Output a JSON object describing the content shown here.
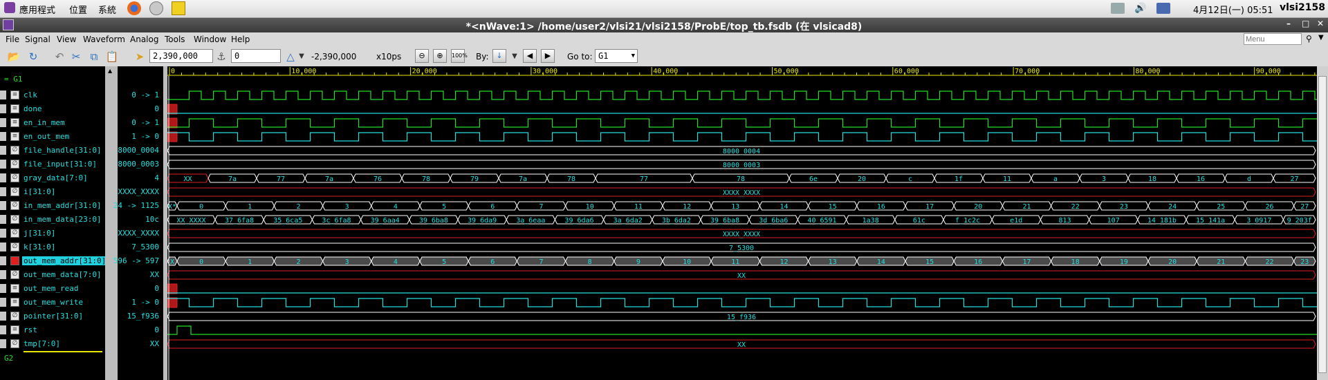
{
  "desktop": {
    "apps_label": "應用程式",
    "places_label": "位置",
    "system_label": "系統",
    "clock": "4月12日(一) 05:51",
    "user": "vlsi2158"
  },
  "window": {
    "title": "*<nWave:1> /home/user2/vlsi21/vlsi2158/ProbE/top_tb.fsdb (在 vlsicad8)"
  },
  "menu": {
    "items": [
      "File",
      "Signal",
      "View",
      "Waveform",
      "Analog",
      "Tools",
      "Window",
      "Help"
    ],
    "search_placeholder": "Menu"
  },
  "toolbar": {
    "cursor_time": "2,390,000",
    "marker_time": "0",
    "delta": "-2,390,000",
    "unit": "x10ps",
    "zoom_fit": "100%",
    "by_label": "By:",
    "goto_label": "Go to:",
    "goto_value": "G1"
  },
  "ruler": {
    "labels": [
      "0",
      "10,000",
      "20,000",
      "30,000",
      "40,000",
      "50,000",
      "60,000",
      "70,000",
      "80,000",
      "90,000"
    ]
  },
  "groups": {
    "g1": "G1",
    "g2": "G2"
  },
  "signals": [
    {
      "name": "clk",
      "value": "0 -> 1",
      "kind": "bit"
    },
    {
      "name": "done",
      "value": "0",
      "kind": "bit"
    },
    {
      "name": "en_in_mem",
      "value": "0 -> 1",
      "kind": "bit"
    },
    {
      "name": "en_out_mem",
      "value": "1 -> 0",
      "kind": "bit"
    },
    {
      "name": "file_handle[31:0]",
      "value": "8000_0004",
      "kind": "bus"
    },
    {
      "name": "file_input[31:0]",
      "value": "8000_0003",
      "kind": "bus"
    },
    {
      "name": "gray_data[7:0]",
      "value": "4",
      "kind": "bus"
    },
    {
      "name": "i[31:0]",
      "value": "XXXX_XXXX",
      "kind": "bus"
    },
    {
      "name": "in_mem_addr[31:0]",
      "value": "24 -> 1125",
      "kind": "bus"
    },
    {
      "name": "in_mem_data[23:0]",
      "value": "10c",
      "kind": "bus"
    },
    {
      "name": "j[31:0]",
      "value": "XXXX_XXXX",
      "kind": "bus"
    },
    {
      "name": "k[31:0]",
      "value": "7_5300",
      "kind": "bus"
    },
    {
      "name": "out_mem_addr[31:0]",
      "value": "596 -> 597",
      "kind": "bus",
      "selected": true
    },
    {
      "name": "out_mem_data[7:0]",
      "value": "XX",
      "kind": "bus"
    },
    {
      "name": "out_mem_read",
      "value": "0",
      "kind": "bit"
    },
    {
      "name": "out_mem_write",
      "value": "1 -> 0",
      "kind": "bit"
    },
    {
      "name": "pointer[31:0]",
      "value": "15_f936",
      "kind": "bus"
    },
    {
      "name": "rst",
      "value": "0",
      "kind": "bit"
    },
    {
      "name": "tmp[7:0]",
      "value": "XX",
      "kind": "bus"
    }
  ],
  "waves": {
    "file_handle": "8000_0004",
    "file_input": "8000_0003",
    "gray_data_first": "XX",
    "gray_data": [
      "7a",
      "77",
      "7a",
      "76",
      "78",
      "79",
      "7a",
      "78",
      "77",
      "78",
      "6e",
      "20",
      "c",
      "1f",
      "11",
      "a",
      "3",
      "18",
      "16",
      "d",
      "27"
    ],
    "i": "XXXX_XXXX",
    "in_mem_addr_first": "X*",
    "in_mem_addr": [
      "0",
      "1",
      "2",
      "3",
      "4",
      "5",
      "6",
      "7",
      "10",
      "11",
      "12",
      "13",
      "14",
      "15",
      "16",
      "17",
      "20",
      "21",
      "22",
      "23",
      "24",
      "25",
      "26",
      "27"
    ],
    "in_mem_data_first": "XX_XXXX",
    "in_mem_data": [
      "37_6fa8",
      "35_6ca5",
      "3c_6fa8",
      "39_6aa4",
      "39_6ba8",
      "39_6da9",
      "3a_6eaa",
      "39_6da6",
      "3a_6da2",
      "3b_6da2",
      "39_6ba8",
      "3d_6ba6",
      "40_6591",
      "1a38",
      "61c",
      "f_1c2c",
      "e1d",
      "813",
      "107",
      "14_181b",
      "15_141a",
      "3_0917",
      "9_203f"
    ],
    "j": "XXXX_XXXX",
    "k": "7_5300",
    "out_mem_addr_first": "X",
    "out_mem_addr": [
      "0",
      "1",
      "2",
      "3",
      "4",
      "5",
      "6",
      "7",
      "8",
      "9",
      "10",
      "11",
      "12",
      "13",
      "14",
      "15",
      "16",
      "17",
      "18",
      "19",
      "20",
      "21",
      "22",
      "23"
    ],
    "out_mem_data": "XX",
    "pointer": "15_f936",
    "tmp": "XX"
  },
  "colors": {
    "background": "#000000",
    "wave_bit": "#22e022",
    "wave_bus": "#ffffff",
    "wave_x": "#e02020",
    "signal_name": "#22e0e0",
    "ruler": "#e8e800"
  }
}
